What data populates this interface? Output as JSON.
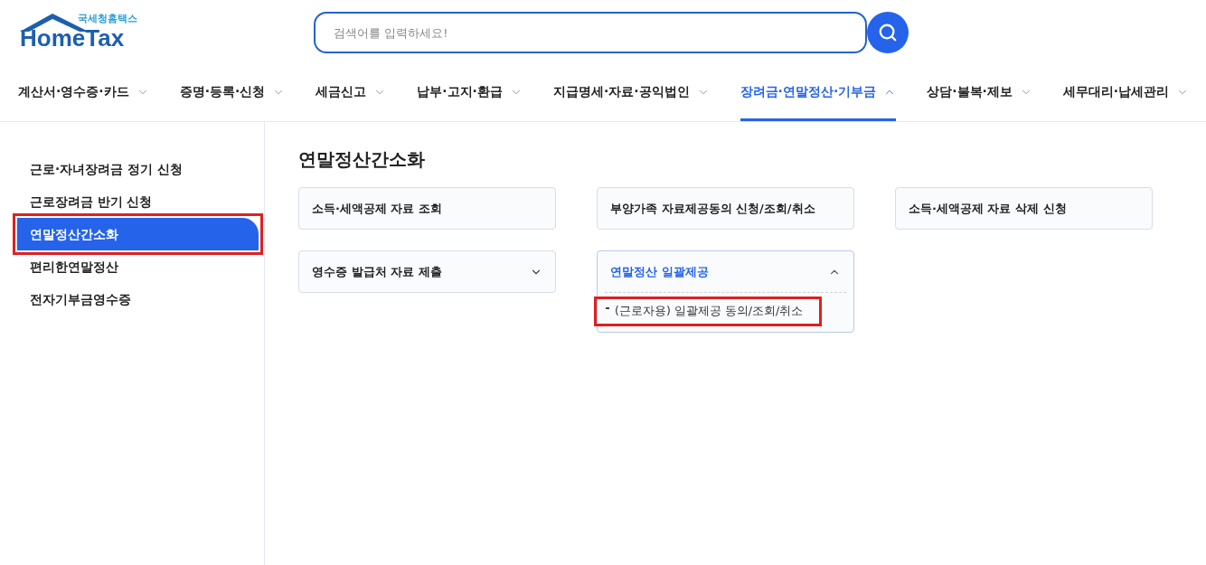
{
  "logo": {
    "subtitle": "국세청홈택스",
    "wordmark": "HomeTax"
  },
  "search": {
    "placeholder": "검색어를 입력하세요!"
  },
  "nav": [
    {
      "label": "계산서·영수증·카드",
      "selected": false
    },
    {
      "label": "증명·등록·신청",
      "selected": false
    },
    {
      "label": "세금신고",
      "selected": false
    },
    {
      "label": "납부·고지·환급",
      "selected": false
    },
    {
      "label": "지급명세·자료·공익법인",
      "selected": false
    },
    {
      "label": "장려금·연말정산·기부금",
      "selected": true
    },
    {
      "label": "상담·불복·제보",
      "selected": false
    },
    {
      "label": "세무대리·납세관리",
      "selected": false
    }
  ],
  "sidebar": {
    "items": [
      {
        "label": "근로·자녀장려금 정기 신청",
        "selected": false,
        "highlighted": false
      },
      {
        "label": "근로장려금 반기 신청",
        "selected": false,
        "highlighted": false
      },
      {
        "label": "연말정산간소화",
        "selected": true,
        "highlighted": true
      },
      {
        "label": "편리한연말정산",
        "selected": false,
        "highlighted": false
      },
      {
        "label": "전자기부금영수증",
        "selected": false,
        "highlighted": false
      }
    ]
  },
  "page_title": "연말정산간소화",
  "cards": [
    {
      "kind": "link",
      "label": "소득·세액공제 자료 조회"
    },
    {
      "kind": "link",
      "label": "부양가족 자료제공동의 신청/조회/취소"
    },
    {
      "kind": "link",
      "label": "소득·세액공제 자료 삭제 신청"
    },
    {
      "kind": "dropdown",
      "label": "영수증 발급처 자료 제출",
      "expanded": false
    },
    {
      "kind": "dropdown",
      "label": "연말정산 일괄제공",
      "expanded": true,
      "children": [
        {
          "label": "(근로자용) 일괄제공 동의/조회/취소",
          "highlighted": true
        }
      ]
    }
  ]
}
